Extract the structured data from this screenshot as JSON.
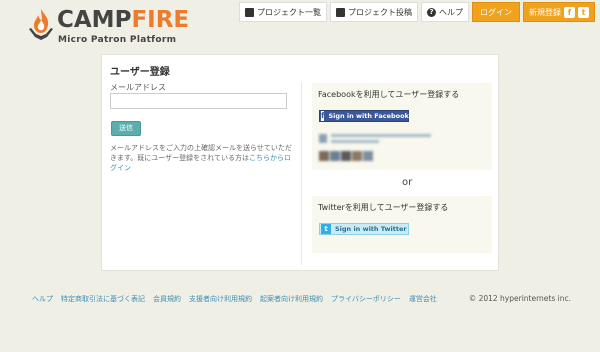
{
  "logo": {
    "camp": "CAMP",
    "fire": "FIRE",
    "subtitle": "Micro Patron Platform"
  },
  "nav": {
    "items": [
      {
        "label": "プロジェクト一覧",
        "icon": "home-icon"
      },
      {
        "label": "プロジェクト投稿",
        "icon": "upload-icon"
      },
      {
        "label": "ヘルプ",
        "icon": "help-icon"
      }
    ],
    "login": "ログイン",
    "register": "新規登録",
    "fb_glyph": "f",
    "tw_glyph": "t",
    "help_glyph": "?"
  },
  "form": {
    "title": "ユーザー登録",
    "email_label": "メールアドレス",
    "email_value": "",
    "submit": "送信",
    "note_text": "メールアドレスをご入力の上確認メールを送らせていただきます。既にユーザー登録をされている方は",
    "note_link": "こちらからログイン"
  },
  "social": {
    "facebook_title": "Facebookを利用してユーザー登録する",
    "facebook_button": "Sign in with Facebook",
    "facebook_glyph": "f",
    "or": "or",
    "twitter_title": "Twitterを利用してユーザー登録する",
    "twitter_button": "Sign in with Twitter",
    "twitter_glyph": "t"
  },
  "footer": {
    "links": [
      "ヘルプ",
      "特定商取引法に基づく表記",
      "会員規約",
      "支援者向け利用規約",
      "起案者向け利用規約",
      "プライバシーポリシー",
      "運営会社"
    ],
    "copyright": "© 2012 hyperinternets inc."
  },
  "colors": {
    "accent": "#f0a21e",
    "fire": "#ee7b2b",
    "facebook": "#3b5998",
    "twitter": "#33aee0",
    "link": "#3b8fb5",
    "submit": "#5cadad"
  }
}
